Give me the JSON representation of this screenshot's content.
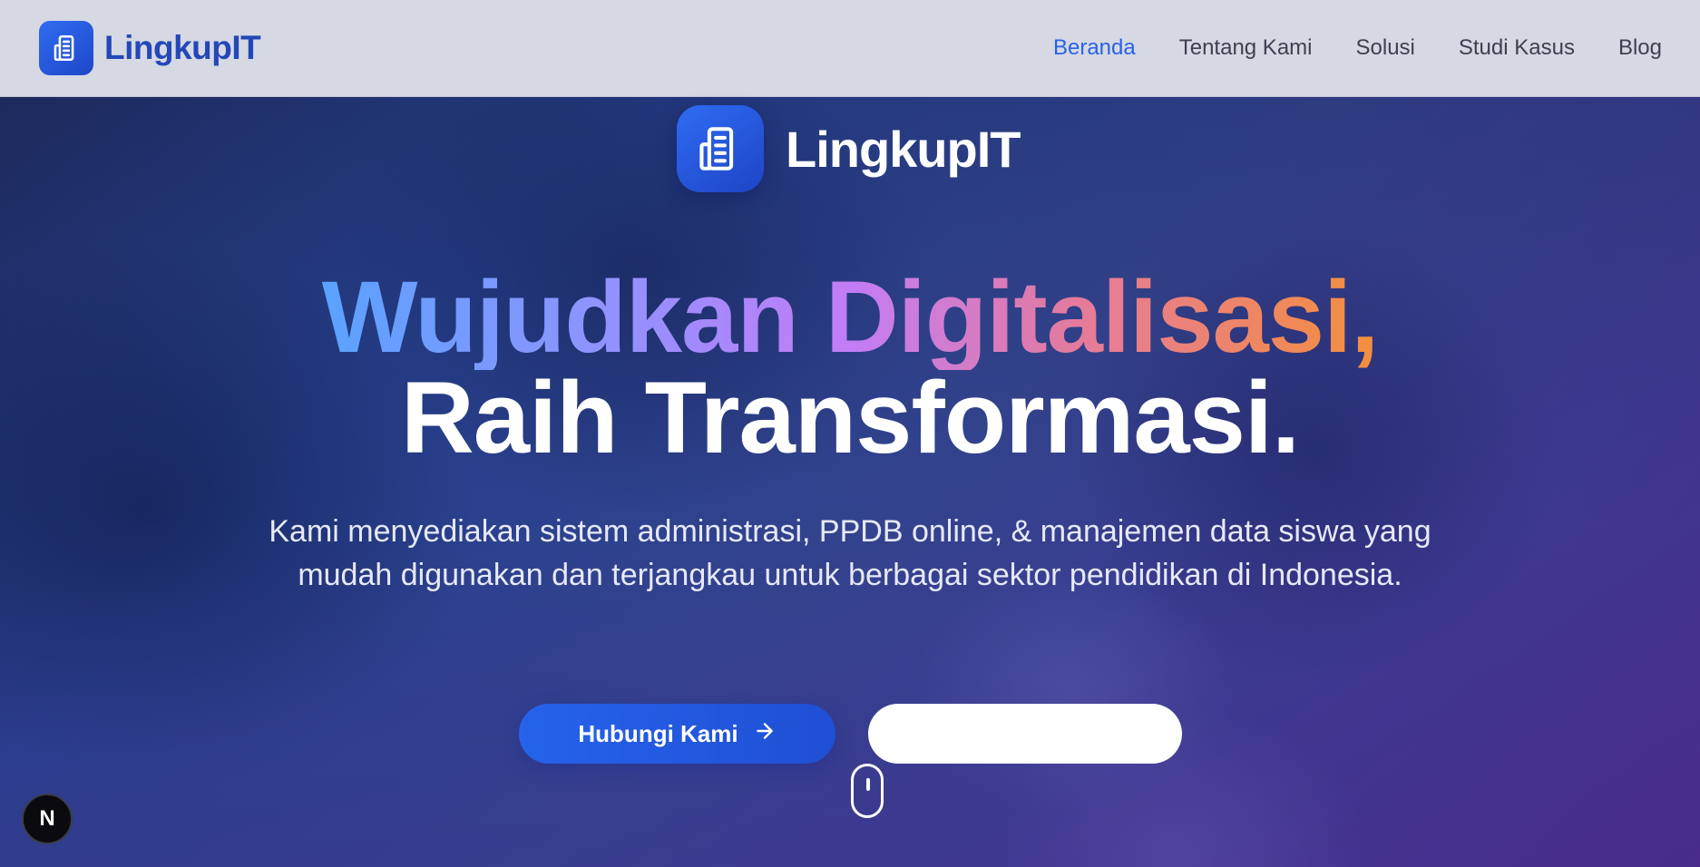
{
  "navbar": {
    "brand_name": "LingkupIT",
    "links": [
      {
        "label": "Beranda",
        "active": true
      },
      {
        "label": "Tentang Kami",
        "active": false
      },
      {
        "label": "Solusi",
        "active": false
      },
      {
        "label": "Studi Kasus",
        "active": false
      },
      {
        "label": "Blog",
        "active": false
      }
    ]
  },
  "hero": {
    "logo_name": "LingkupIT",
    "headline_line1": "Wujudkan Digitalisasi,",
    "headline_line2": "Raih Transformasi.",
    "subtitle": "Kami menyediakan sistem administrasi, PPDB online, & manajemen data siswa yang mudah digunakan dan terjangkau untuk berbagai sektor pendidikan di Indonesia.",
    "primary_button_label": "Hubungi Kami",
    "secondary_button_label": ""
  },
  "dev_badge": {
    "label": "N"
  },
  "colors": {
    "brand_blue": "#2447b8",
    "active_link": "#2a62e4",
    "button_primary": "#2563eb",
    "headline_gradient": [
      "#5aa2ff",
      "#8f93ff",
      "#c27cf6",
      "#e57b9a",
      "#f48f3c"
    ]
  },
  "icons": {
    "brand": "building-icon",
    "arrow": "arrow-right-icon",
    "scroll": "mouse-scroll-icon"
  }
}
